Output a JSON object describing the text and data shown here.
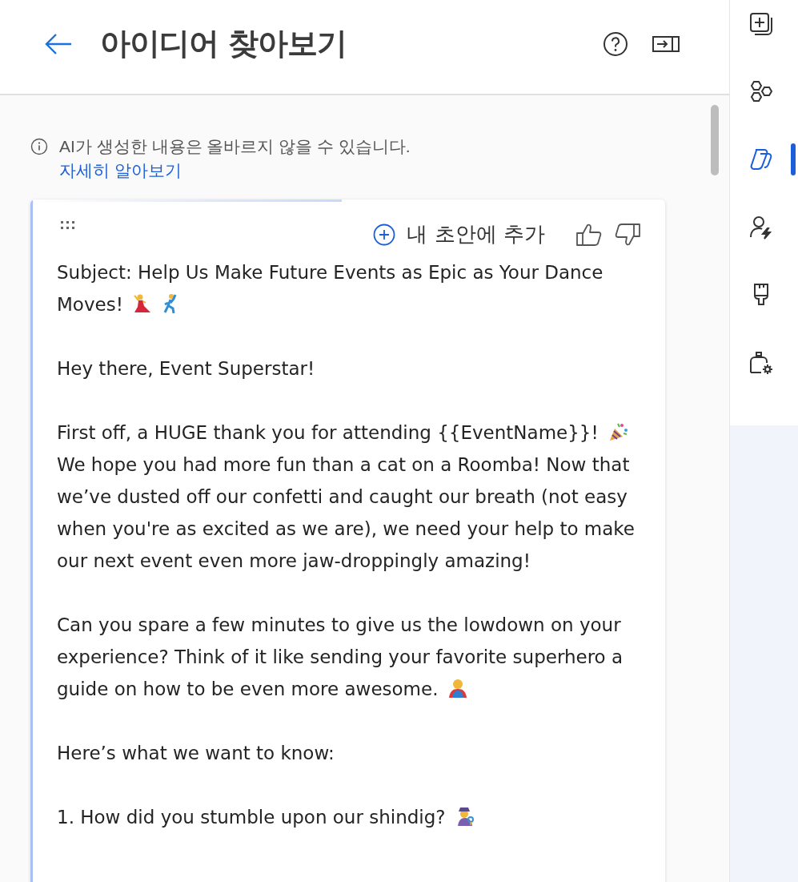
{
  "header": {
    "title": "아이디어 찾아보기"
  },
  "notice": {
    "text": "AI가 생성한 내용은 올바르지 않을 수 있습니다.",
    "link": "자세히 알아보기"
  },
  "card": {
    "add_button": "내 초안에 추가",
    "paragraphs": [
      {
        "parts": [
          {
            "kind": "text",
            "text": "Subject: Help Us Make Future Events as Epic as Your Dance Moves! "
          },
          {
            "kind": "dancer"
          },
          {
            "kind": "dancing-man"
          }
        ]
      },
      {
        "parts": [
          {
            "kind": "text",
            "text": "Hey there, Event Superstar!"
          }
        ]
      },
      {
        "parts": [
          {
            "kind": "text",
            "text": "First off, a HUGE thank you for attending {{EventName}}! "
          },
          {
            "kind": "party-popper"
          },
          {
            "kind": "text",
            "text": " We hope you had more fun than a cat on a Roomba! Now that we’ve dusted off our confetti and caught our breath (not easy when you're as excited as we are), we need your help to make our next event even more jaw-droppingly amazing!"
          }
        ]
      },
      {
        "parts": [
          {
            "kind": "text",
            "text": "Can you spare a few minutes to give us the lowdown on your experience? Think of it like sending your favorite superhero a guide on how to be even more awesome. "
          },
          {
            "kind": "superhero"
          }
        ]
      },
      {
        "parts": [
          {
            "kind": "text",
            "text": "Here’s what we want to know:"
          }
        ]
      },
      {
        "parts": [
          {
            "kind": "text",
            "text": "1. How did you stumble upon our shindig? "
          },
          {
            "kind": "detective"
          }
        ]
      }
    ]
  },
  "sidebar": {
    "items": [
      {
        "kind": "add-page",
        "selected": false
      },
      {
        "kind": "hexagons",
        "selected": false
      },
      {
        "kind": "copilot",
        "selected": true
      },
      {
        "kind": "person-bolt",
        "selected": false
      },
      {
        "kind": "brush",
        "selected": false
      },
      {
        "kind": "mailbox-gear",
        "selected": false
      }
    ]
  }
}
